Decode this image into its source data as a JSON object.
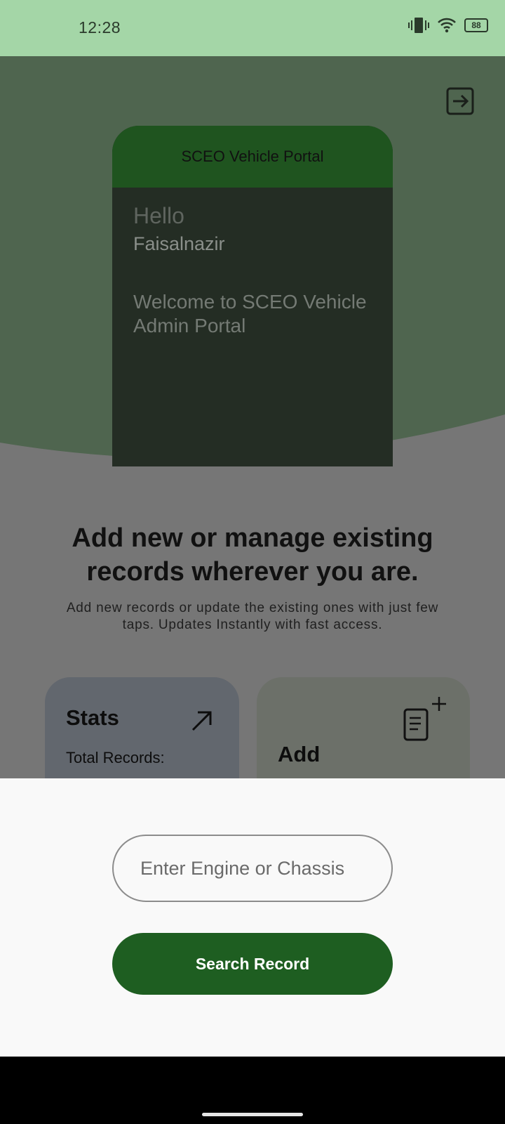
{
  "status_bar": {
    "time": "12:28",
    "battery": "88"
  },
  "card": {
    "title": "SCEO Vehicle Portal",
    "greeting": "Hello",
    "username": "Faisalnazir",
    "welcome": "Welcome to SCEO Vehicle Admin Portal"
  },
  "main": {
    "headline": "Add new or manage existing records wherever you are.",
    "subtext": "Add new records or update the existing ones with just few taps. Updates Instantly with fast access."
  },
  "tiles": {
    "stats_title": "Stats",
    "stats_sub": "Total Records:",
    "add_title": "Add"
  },
  "sheet": {
    "input_placeholder": "Enter Engine or Chassis",
    "input_value": "",
    "search_label": "Search Record"
  },
  "colors": {
    "status_bar": "#a4d6a7",
    "brand_green": "#1e5e21",
    "scrim": "#767676"
  },
  "icons": [
    "vibrate-icon",
    "wifi-icon",
    "battery-icon",
    "logout-icon",
    "arrow-up-right-icon",
    "document-add-icon"
  ]
}
